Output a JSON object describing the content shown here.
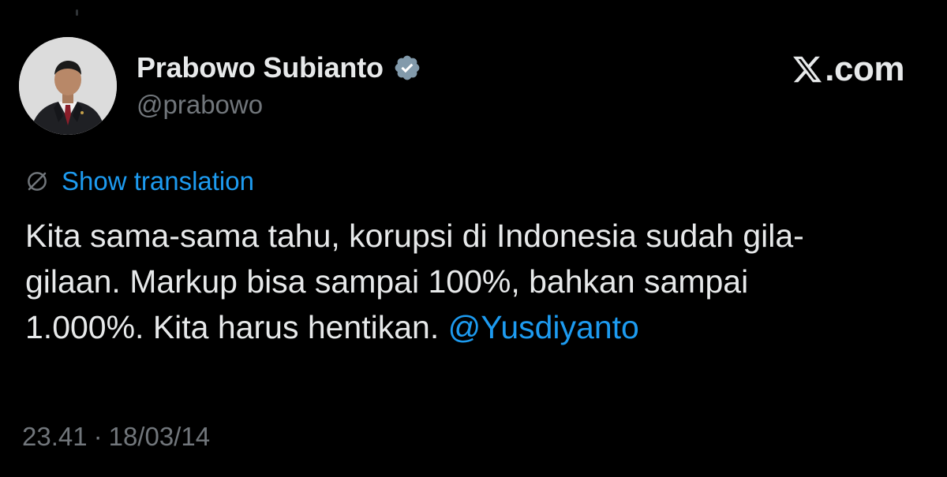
{
  "author": {
    "display_name": "Prabowo Subianto",
    "handle": "@prabowo",
    "verified": true,
    "avatar_icon": "profile-photo"
  },
  "brand": {
    "icon": "x-logo-icon",
    "text": ".com"
  },
  "translation": {
    "label": "Show translation",
    "icon": "translate-icon"
  },
  "tweet": {
    "text_line_1": "Kita sama-sama tahu, korupsi di Indonesia sudah gila-",
    "text_line_2": "gilaan. Markup bisa sampai 100%, bahkan sampai",
    "text_line_3": "1.000%. Kita harus hentikan. ",
    "mention": "@Yusdiyanto"
  },
  "meta": {
    "time": "23.41",
    "separator": "·",
    "date": "18/03/14"
  },
  "colors": {
    "background": "#000000",
    "primary_text": "#e7e9ea",
    "secondary_text": "#71767b",
    "link": "#1d9bf0"
  }
}
